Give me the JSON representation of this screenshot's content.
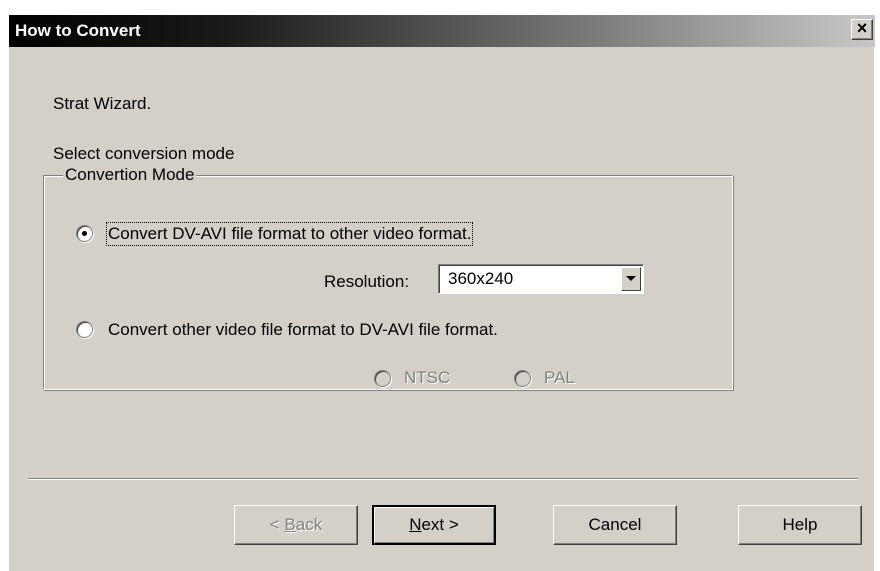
{
  "window": {
    "title": "How to Convert",
    "close_label": "×"
  },
  "intro_text": "Strat Wizard.",
  "instruction_text": "Select conversion mode",
  "group": {
    "legend": "Convertion Mode",
    "options": [
      {
        "label": "Convert DV-AVI file format to other video format.",
        "checked": true
      },
      {
        "label": "Convert other video file format to DV-AVI file format.",
        "checked": false
      }
    ],
    "resolution": {
      "label": "Resolution:",
      "value": "360x240"
    },
    "standards": [
      {
        "label": "NTSC",
        "enabled": false
      },
      {
        "label": "PAL",
        "enabled": false
      }
    ]
  },
  "buttons": {
    "back": {
      "prefix": "< ",
      "mnemonic": "B",
      "rest": "ack",
      "enabled": false
    },
    "next": {
      "mnemonic": "N",
      "rest": "ext >"
    },
    "cancel": "Cancel",
    "help": "Help"
  },
  "colors": {
    "dialog_face": "#d4d0c8",
    "title_start": "#000000",
    "title_end": "#c8c8c8",
    "disabled_text": "#808080"
  },
  "icons": {
    "close": "close-icon",
    "dropdown": "chevron-down-icon"
  }
}
